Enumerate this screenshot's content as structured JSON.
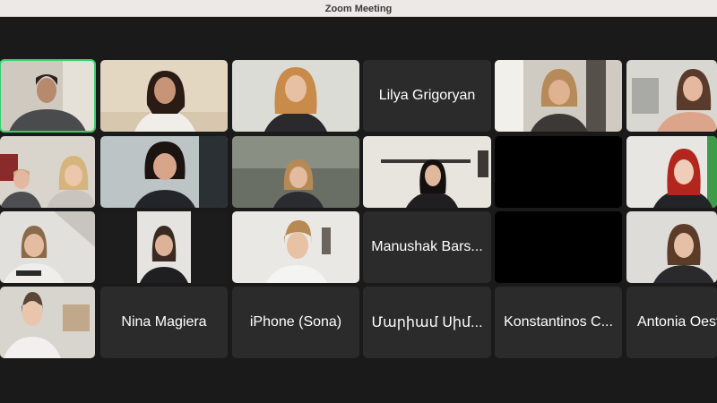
{
  "window": {
    "title": "Zoom Meeting"
  },
  "participants": [
    {
      "name": "",
      "type": "video",
      "active_speaker": true
    },
    {
      "name": "",
      "type": "video"
    },
    {
      "name": "",
      "type": "video"
    },
    {
      "name": "Lilya Grigoryan",
      "type": "name-only"
    },
    {
      "name": "",
      "type": "video"
    },
    {
      "name": "",
      "type": "video"
    },
    {
      "name": "",
      "type": "video"
    },
    {
      "name": "",
      "type": "video"
    },
    {
      "name": "",
      "type": "video"
    },
    {
      "name": "",
      "type": "video"
    },
    {
      "name": "",
      "type": "blank"
    },
    {
      "name": "",
      "type": "video"
    },
    {
      "name": "",
      "type": "video"
    },
    {
      "name": "",
      "type": "video"
    },
    {
      "name": "",
      "type": "video"
    },
    {
      "name": "Manushak Bars...",
      "type": "name-only"
    },
    {
      "name": "",
      "type": "blank"
    },
    {
      "name": "",
      "type": "video"
    },
    {
      "name": "",
      "type": "video"
    },
    {
      "name": "Nina Magiera",
      "type": "name-only"
    },
    {
      "name": "iPhone (Sona)",
      "type": "name-only"
    },
    {
      "name": "Մարիամ Սիմ...",
      "type": "name-only"
    },
    {
      "name": "Konstantinos C...",
      "type": "name-only"
    },
    {
      "name": "Antonia Oest",
      "type": "name-only"
    }
  ]
}
